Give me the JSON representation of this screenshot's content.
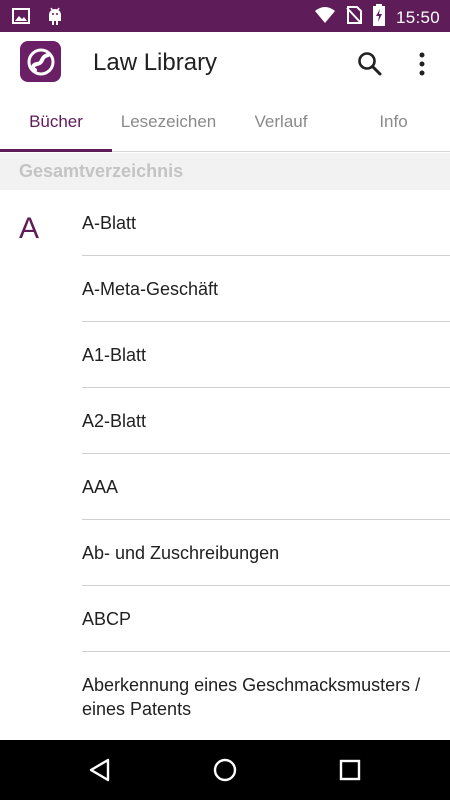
{
  "status_bar": {
    "time": "15:50",
    "icons_left": [
      "gallery-icon",
      "android-debug-icon"
    ],
    "icons_right": [
      "wifi-icon",
      "no-sim-icon",
      "battery-charging-icon"
    ]
  },
  "app_bar": {
    "title": "Law Library",
    "logo_icon": "app-logo-icon",
    "actions": [
      "search-icon",
      "more-vert-icon"
    ]
  },
  "tabs": [
    {
      "label": "Bücher",
      "active": true
    },
    {
      "label": "Lesezeichen",
      "active": false
    },
    {
      "label": "Verlauf",
      "active": false
    },
    {
      "label": "Info",
      "active": false
    }
  ],
  "section": {
    "title": "Gesamtverzeichnis"
  },
  "list": {
    "letter": "A",
    "items": [
      "A-Blatt",
      "A-Meta-Geschäft",
      "A1-Blatt",
      "A2-Blatt",
      "AAA",
      "Ab- und Zuschreibungen",
      "ABCP",
      "Aberkennung eines Geschmacksmusters / eines Patents"
    ]
  },
  "nav_bar": {
    "buttons": [
      "back-icon",
      "home-icon",
      "recents-icon"
    ]
  },
  "colors": {
    "primary": "#5e1d59",
    "text": "#212121",
    "muted": "#8a8a8a"
  }
}
